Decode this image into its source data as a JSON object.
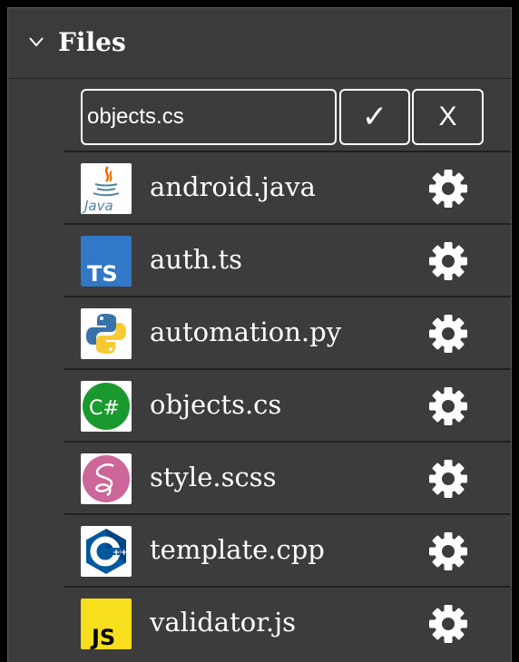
{
  "header": {
    "title": "Files",
    "chevron_icon": "chevron-down-icon"
  },
  "rename": {
    "value": "objects.cs",
    "confirm_label": "✓",
    "cancel_label": "X"
  },
  "files": [
    {
      "name": "android.java",
      "icon": "java-icon"
    },
    {
      "name": "auth.ts",
      "icon": "typescript-icon"
    },
    {
      "name": "automation.py",
      "icon": "python-icon"
    },
    {
      "name": "objects.cs",
      "icon": "csharp-icon"
    },
    {
      "name": "style.scss",
      "icon": "sass-icon"
    },
    {
      "name": "template.cpp",
      "icon": "cpp-icon"
    },
    {
      "name": "validator.js",
      "icon": "javascript-icon"
    }
  ],
  "colors": {
    "panel_bg": "#3c3c3c",
    "text": "#ffffff",
    "divider": "#202020",
    "typescript": "#3178c6",
    "csharp": "#1a9a2e",
    "sass": "#cd6799",
    "javascript": "#f7df1e",
    "cpp": "#00599c"
  }
}
